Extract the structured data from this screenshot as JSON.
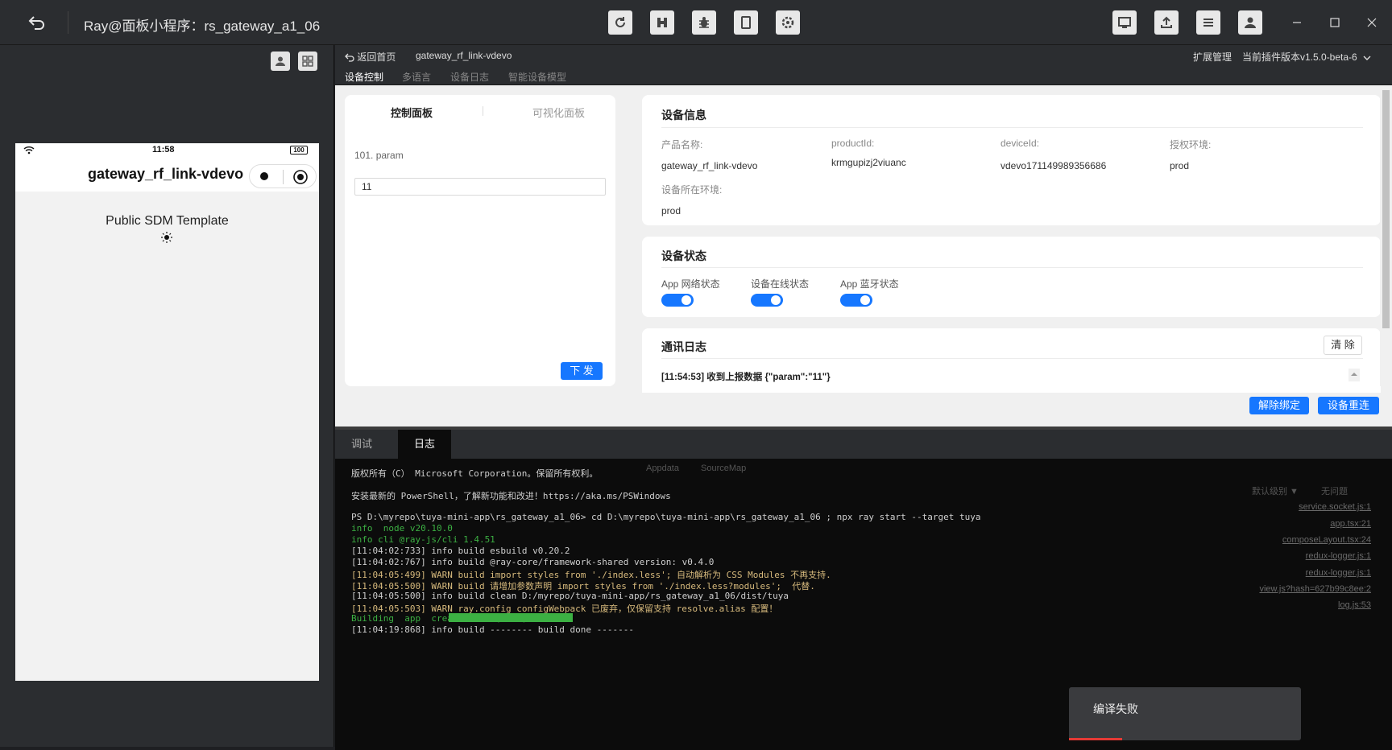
{
  "titlebar": {
    "title": "Ray@面板小程序：rs_gateway_a1_06",
    "tools": [
      "refresh-icon",
      "compile-icon",
      "debug-icon",
      "preview-icon",
      "settings-icon"
    ],
    "right_tools": [
      "dashboard-icon",
      "upload-icon",
      "menu-icon",
      "user-icon"
    ],
    "window": [
      "minimize",
      "maximize",
      "close"
    ]
  },
  "simulator": {
    "status_time": "11:58",
    "battery": "100",
    "nav_title": "gateway_rf_link-vdevo",
    "content_text": "Public SDM Template"
  },
  "plugin": {
    "back_label": "返回首页",
    "device_name": "gateway_rf_link-vdevo",
    "ext_manage": "扩展管理",
    "plugin_version": "当前插件版本v1.5.0-beta-6",
    "tabs": [
      "设备控制",
      "多语言",
      "设备日志",
      "智能设备模型"
    ],
    "panel_tabs": [
      "控制面板",
      "可视化面板"
    ],
    "param_label": "101. param",
    "param_value": "11",
    "send_btn": "下 发",
    "device_info": {
      "title": "设备信息",
      "product_name_label": "产品名称:",
      "product_name": "gateway_rf_link-vdevo",
      "product_id_label": "productId:",
      "product_id": "krmgupizj2viuanc",
      "device_id_label": "deviceId:",
      "device_id": "vdevo171149989356686",
      "auth_env_label": "授权环境:",
      "auth_env": "prod",
      "device_env_label": "设备所在环境:",
      "device_env": "prod"
    },
    "device_status": {
      "title": "设备状态",
      "items": [
        "App 网络状态",
        "设备在线状态",
        "App 蓝牙状态"
      ]
    },
    "comm_log": {
      "title": "通讯日志",
      "clear_btn": "清 除",
      "entry": "[11:54:53] 收到上报数据 {\"param\":\"11\"}"
    },
    "unbind_btn": "解除绑定",
    "reconnect_btn": "设备重连"
  },
  "console": {
    "tabs": [
      "调试",
      "日志"
    ],
    "ghost_tabs": [
      "Appdata",
      "SourceMap"
    ],
    "ghost_level": "默认级别 ▼",
    "ghost_group": "无问题",
    "ghost_links": [
      "service.socket.js:1",
      "app.tsx:21",
      "composeLayout.tsx:24",
      "redux-logger.js:1",
      "redux-logger.js:1",
      "view.js?hash=627b99c8ee:2",
      "log.js:53"
    ],
    "lines": [
      {
        "t": "版权所有（C） Microsoft Corporation。保留所有权利。"
      },
      {
        "t": "安装最新的 PowerShell，了解新功能和改进！https://aka.ms/PSWindows"
      },
      {
        "t": "PS D:\\myrepo\\tuya-mini-app\\rs_gateway_a1_06> cd D:\\myrepo\\tuya-mini-app\\rs_gateway_a1_06 ; npx ray start --target tuya"
      },
      {
        "t": "info  node v20.10.0"
      },
      {
        "t": "info cli @ray-js/cli 1.4.51"
      },
      {
        "t": "[11:04:02:733] info build esbuild v0.20.2"
      },
      {
        "t": "[11:04:02:767] info build @ray-core/framework-shared version: v0.4.0"
      },
      {
        "t": "[11:04:05:499] WARN build import styles from './index.less'; 自动解析为 CSS Modules 不再支持."
      },
      {
        "t": "[11:04:05:500] WARN build 请增加参数声明 import styles from './index.less?modules';  代替."
      },
      {
        "t": "[11:04:05:500] info build clean D:/myrepo/tuya-mini-app/rs_gateway_a1_06/dist/tuya"
      },
      {
        "t": "[11:04:05:503] WARN ray.config configWebpack 已废弃，仅保留支持 resolve.alias 配置！"
      },
      {
        "t": "Building  app  create-i18n (100%) 14.0s"
      },
      {
        "t": "[11:04:19:868] info build -------- build done -------"
      }
    ]
  },
  "toast": {
    "text": "编译失败"
  },
  "colors": {
    "accent": "#1677ff",
    "warn": "#c9a000",
    "progress": "#3cb043",
    "error": "#e53935"
  }
}
